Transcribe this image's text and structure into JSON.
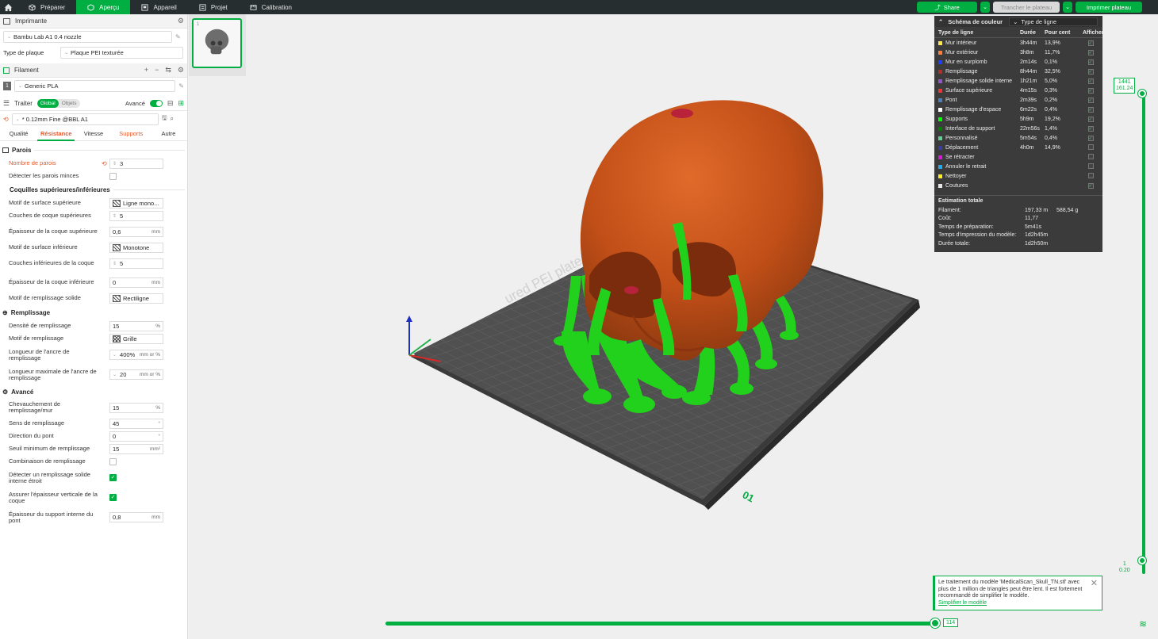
{
  "topbar": {
    "tabs": [
      {
        "label": "Préparer",
        "icon": "cube-icon"
      },
      {
        "label": "Aperçu",
        "icon": "preview-icon"
      },
      {
        "label": "Appareil",
        "icon": "device-icon"
      },
      {
        "label": "Projet",
        "icon": "project-icon"
      },
      {
        "label": "Calibration",
        "icon": "calibration-icon"
      }
    ],
    "active_tab": "Aperçu",
    "share_label": "Share",
    "slice_label": "Trancher le plateau",
    "print_label": "Imprimer plateau",
    "accent": "#00ae42",
    "bar_color": "#262e30"
  },
  "printer": {
    "section_label": "Imprimante",
    "name": "Bambu Lab A1 0.4 nozzle",
    "plate_type_label": "Type de plaque",
    "plate_type_value": "Plaque PEI texturée"
  },
  "filament": {
    "section_label": "Filament",
    "slot": "1",
    "name": "Generic PLA"
  },
  "process": {
    "section_label": "Traiter",
    "toggle_global": "Global",
    "toggle_objects": "Objets",
    "advanced_label": "Avancé",
    "preset": "* 0.12mm Fine @BBL A1",
    "tabs": [
      "Qualité",
      "Résistance",
      "Vitesse",
      "Supports",
      "Autre"
    ],
    "active_tab": "Résistance"
  },
  "groups": {
    "walls": "Parois",
    "shells": "Coquilles supérieures/inférieures",
    "infill": "Remplissage",
    "advanced": "Avancé"
  },
  "params": {
    "wall_loops": {
      "label": "Nombre de parois",
      "value": "3"
    },
    "detect_thin": {
      "label": "Détecter les parois minces"
    },
    "top_pattern": {
      "label": "Motif de surface supérieure",
      "value": "Ligne mono..."
    },
    "top_layers": {
      "label": "Couches de coque supérieures",
      "value": "5"
    },
    "top_thickness": {
      "label": "Épaisseur de la coque supérieure",
      "value": "0,6",
      "unit": "mm"
    },
    "bottom_pattern": {
      "label": "Motif de surface inférieure",
      "value": "Monotone"
    },
    "bottom_layers": {
      "label": "Couches inférieures de la coque",
      "value": "5"
    },
    "bottom_thickness": {
      "label": "Épaisseur de la coque inférieure",
      "value": "0",
      "unit": "mm"
    },
    "solid_pattern": {
      "label": "Motif de remplissage solide",
      "value": "Rectiligne"
    },
    "infill_density": {
      "label": "Densité de remplissage",
      "value": "15",
      "unit": "%"
    },
    "infill_pattern": {
      "label": "Motif de remplissage",
      "value": "Grille"
    },
    "anchor_len": {
      "label": "Longueur de l'ancre de remplissage",
      "value": "400%",
      "unit": "mm or %"
    },
    "anchor_max": {
      "label": "Longueur maximale de l'ancre de remplissage",
      "value": "20",
      "unit": "mm or %"
    },
    "overlap": {
      "label": "Chevauchement de remplissage/mur",
      "value": "15",
      "unit": "%"
    },
    "infill_dir": {
      "label": "Sens de remplissage",
      "value": "45",
      "unit": "°"
    },
    "bridge_dir": {
      "label": "Direction du pont",
      "value": "0",
      "unit": "°"
    },
    "min_area": {
      "label": "Seuil minimum de remplissage",
      "value": "15",
      "unit": "mm²"
    },
    "combine": {
      "label": "Combinaison de remplissage"
    },
    "narrow_solid": {
      "label": "Détecter un remplissage solide interne étroit"
    },
    "ensure_vertical": {
      "label": "Assurer l'épaisseur verticale de la coque"
    },
    "bridge_support": {
      "label": "Épaisseur du support interne du pont",
      "value": "0,8",
      "unit": "mm"
    }
  },
  "legend": {
    "title": "Schéma de couleur",
    "mode": "Type de ligne",
    "headers": [
      "Type de ligne",
      "Durée",
      "Pour cent",
      "Afficher"
    ],
    "rows": [
      {
        "name": "Mur intérieur",
        "time": "3h44m",
        "pct": "13,9%",
        "color": "#ffe64d",
        "shown": true
      },
      {
        "name": "Mur extérieur",
        "time": "3h8m",
        "pct": "11,7%",
        "color": "#ff7d38",
        "shown": true
      },
      {
        "name": "Mur en surplomb",
        "time": "2m14s",
        "pct": "0,1%",
        "color": "#1f3fff",
        "shown": true
      },
      {
        "name": "Remplissage",
        "time": "8h44m",
        "pct": "32,5%",
        "color": "#b03029",
        "shown": true
      },
      {
        "name": "Remplissage solide interne",
        "time": "1h21m",
        "pct": "5,0%",
        "color": "#9654cc",
        "shown": true
      },
      {
        "name": "Surface supérieure",
        "time": "4m15s",
        "pct": "0,3%",
        "color": "#f03333",
        "shown": true
      },
      {
        "name": "Pont",
        "time": "2m39s",
        "pct": "0,2%",
        "color": "#4d80ba",
        "shown": true
      },
      {
        "name": "Remplissage d'espace",
        "time": "6m22s",
        "pct": "0,4%",
        "color": "#ffffff",
        "shown": true
      },
      {
        "name": "Supports",
        "time": "5h9m",
        "pct": "19,2%",
        "color": "#00ff00",
        "shown": true
      },
      {
        "name": "Interface de support",
        "time": "22m56s",
        "pct": "1,4%",
        "color": "#008000",
        "shown": true
      },
      {
        "name": "Personnalisé",
        "time": "5m54s",
        "pct": "0,4%",
        "color": "#5ed194",
        "shown": true
      },
      {
        "name": "Déplacement",
        "time": "4h0m",
        "pct": "14,9%",
        "color": "#383ea2",
        "shown": false
      },
      {
        "name": "Se rétracter",
        "time": "",
        "pct": "",
        "color": "#d819d8",
        "shown": false
      },
      {
        "name": "Annuler le retrait",
        "time": "",
        "pct": "",
        "color": "#22aaee",
        "shown": false
      },
      {
        "name": "Nettoyer",
        "time": "",
        "pct": "",
        "color": "#ffee22",
        "shown": false
      },
      {
        "name": "Coutures",
        "time": "",
        "pct": "",
        "color": "#e6e6e6",
        "shown": true
      }
    ],
    "estimate_title": "Estimation totale",
    "estimates": [
      {
        "k": "Filament:",
        "v1": "197,33 m",
        "v2": "588,54 g"
      },
      {
        "k": "Coût:",
        "v1": "11,77",
        "v2": ""
      },
      {
        "k": "Temps de préparation:",
        "v1": "5m41s",
        "v2": ""
      },
      {
        "k": "Temps d'impression du modèle:",
        "v1": "1d2h45m",
        "v2": ""
      },
      {
        "k": "Durée totale:",
        "v1": "1d2h50m",
        "v2": ""
      }
    ]
  },
  "layer_slider": {
    "top_layer": "1441",
    "top_height": "161.24",
    "bottom_layer": "1",
    "bottom_height": "0.20"
  },
  "move_slider": {
    "value": "114"
  },
  "plate": {
    "number": "01",
    "text": "ured PEI plate"
  },
  "thumbnail": {
    "number": "1"
  },
  "notice": {
    "text": "Le traitement du modèle 'MedicalScan_Skull_TN.stl' avec plus de 1 million de triangles peut être lent. Il est fortement recommandé de simplifier le modèle.",
    "link": "Simplifier le modèle"
  }
}
